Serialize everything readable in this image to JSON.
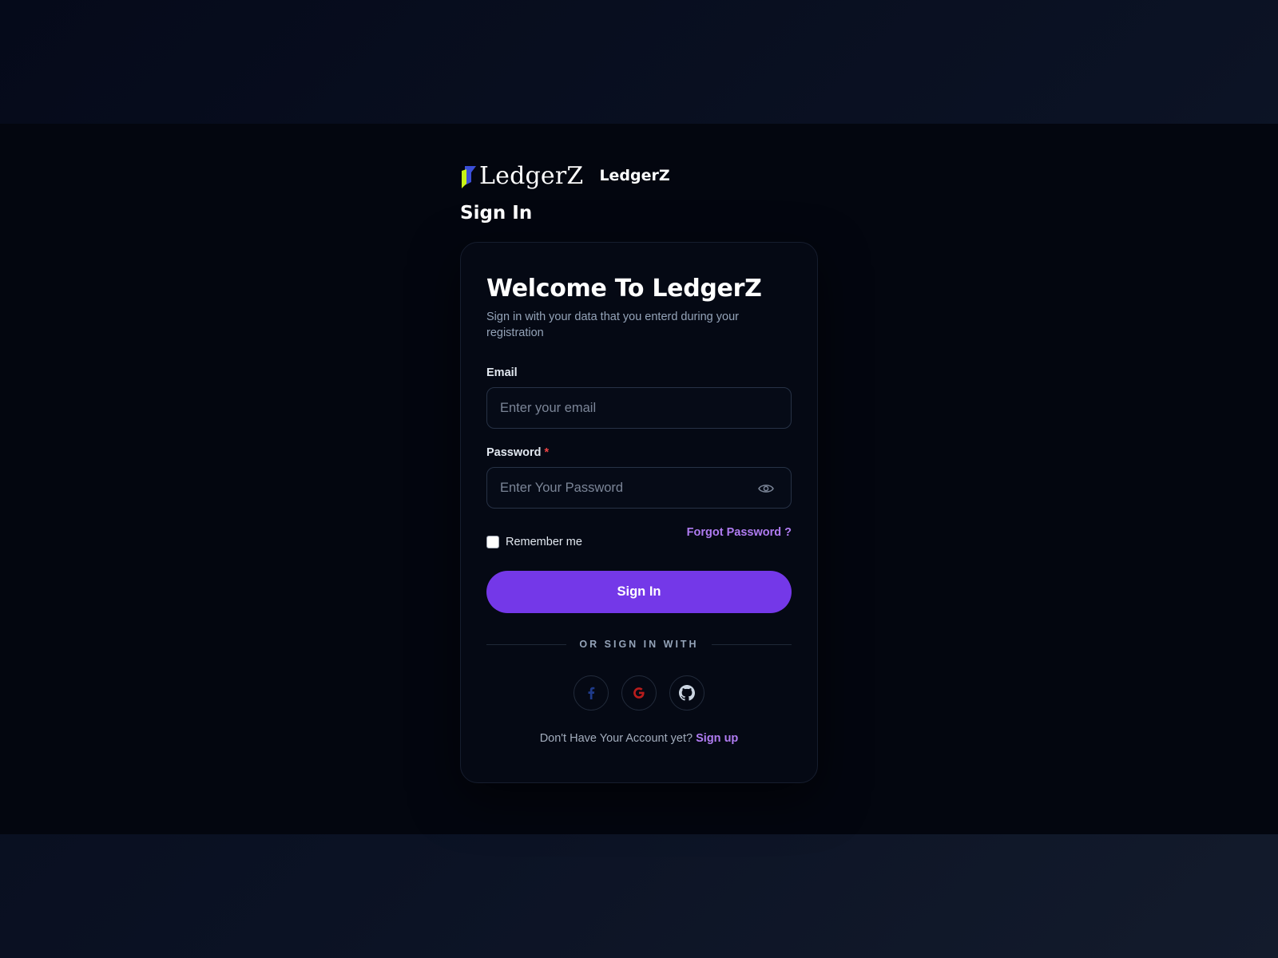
{
  "brand": {
    "logo_text": "LedgerZ",
    "name": "LedgerZ"
  },
  "page": {
    "title": "Sign In"
  },
  "card": {
    "heading": "Welcome To LedgerZ",
    "subtitle": "Sign in with your data that you enterd during your registration"
  },
  "form": {
    "email_label": "Email",
    "email_placeholder": "Enter your email",
    "email_value": "",
    "password_label": "Password",
    "password_required_mark": "*",
    "password_placeholder": "Enter Your Password",
    "password_value": "",
    "remember_label": "Remember me",
    "remember_checked": false,
    "forgot_label": "Forgot Password ?",
    "submit_label": "Sign In"
  },
  "social": {
    "divider_label": "OR SIGN IN WITH",
    "providers": [
      {
        "name": "facebook-icon",
        "color": "#1e3a8a"
      },
      {
        "name": "google-icon",
        "color": "#b91c1c"
      },
      {
        "name": "github-icon",
        "color": "#cbd5e1"
      }
    ]
  },
  "footer": {
    "prompt": "Don't Have Your Account yet?",
    "signup_label": "Sign up"
  },
  "colors": {
    "accent": "#7438e8",
    "link": "#b07cf2",
    "required": "#ef4444",
    "logo_blue": "#3b4fd8",
    "logo_lime": "#c8f216"
  }
}
